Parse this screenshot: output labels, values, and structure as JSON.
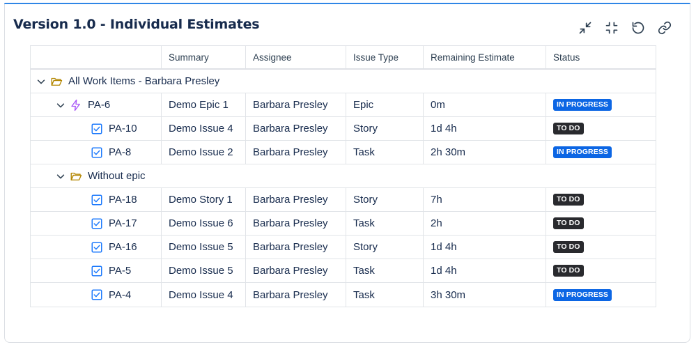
{
  "title": "Version 1.0 - Individual Estimates",
  "toolbar": [
    {
      "name": "collapse-icon"
    },
    {
      "name": "minimize-icon"
    },
    {
      "name": "refresh-icon"
    },
    {
      "name": "link-icon"
    }
  ],
  "columns": [
    "",
    "Summary",
    "Assignee",
    "Issue Type",
    "Remaining Estimate",
    "Status"
  ],
  "groups": [
    {
      "label": "All Work Items - Barbara Presley"
    },
    {
      "label": "Without epic"
    }
  ],
  "epic": {
    "key": "PA-6",
    "summary": "Demo Epic 1",
    "assignee": "Barbara Presley",
    "type": "Epic",
    "estimate": "0m",
    "status": "IN PROGRESS"
  },
  "epic_items": [
    {
      "key": "PA-10",
      "summary": "Demo Issue 4",
      "assignee": "Barbara Presley",
      "type": "Story",
      "estimate": "1d 4h",
      "status": "TO DO"
    },
    {
      "key": "PA-8",
      "summary": "Demo Issue 2",
      "assignee": "Barbara Presley",
      "type": "Task",
      "estimate": "2h 30m",
      "status": "IN PROGRESS"
    }
  ],
  "other_items": [
    {
      "key": "PA-18",
      "summary": "Demo Story 1",
      "assignee": "Barbara Presley",
      "type": "Story",
      "estimate": "7h",
      "status": "TO DO"
    },
    {
      "key": "PA-17",
      "summary": "Demo Issue 6",
      "assignee": "Barbara Presley",
      "type": "Task",
      "estimate": "2h",
      "status": "TO DO"
    },
    {
      "key": "PA-16",
      "summary": "Demo Issue 5",
      "assignee": "Barbara Presley",
      "type": "Story",
      "estimate": "1d 4h",
      "status": "TO DO"
    },
    {
      "key": "PA-5",
      "summary": "Demo Issue 5",
      "assignee": "Barbara Presley",
      "type": "Task",
      "estimate": "1d 4h",
      "status": "TO DO"
    },
    {
      "key": "PA-4",
      "summary": "Demo Issue 4",
      "assignee": "Barbara Presley",
      "type": "Task",
      "estimate": "3h 30m",
      "status": "IN PROGRESS"
    }
  ],
  "colors": {
    "accent": "#2f86e6",
    "in_progress": "#0c66e4",
    "todo": "#292a2e",
    "folder": "#b38600",
    "epic": "#a855f7",
    "check": "#1d7afc"
  }
}
